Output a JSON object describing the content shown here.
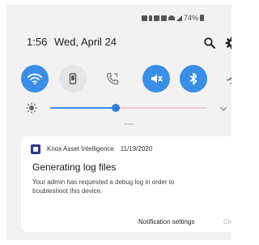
{
  "status_bar": {
    "battery": "74%",
    "icons": [
      "nfc-icon",
      "bluetooth-icon",
      "vibrate-icon",
      "mute-icon",
      "wifi-icon",
      "signal-icon",
      "battery-icon"
    ]
  },
  "header": {
    "time": "1:56",
    "date": "Wed, April 24",
    "search_icon": "search-icon",
    "settings_icon": "gear-icon"
  },
  "quick_settings": [
    {
      "name": "wifi",
      "icon": "wifi-icon",
      "state": "on"
    },
    {
      "name": "portrait",
      "icon": "phone-portrait-icon",
      "state": "off"
    },
    {
      "name": "call",
      "icon": "phone-call-icon",
      "state": "off"
    },
    {
      "name": "mute",
      "icon": "mute-icon",
      "state": "on"
    },
    {
      "name": "bluetooth",
      "icon": "bluetooth-icon",
      "state": "on"
    },
    {
      "name": "airplane",
      "icon": "airplane-icon",
      "state": "off"
    }
  ],
  "brightness": {
    "level": 0.42,
    "icon": "sun-icon",
    "expand_icon": "chevron-down-icon"
  },
  "notification": {
    "app_name": "Knox Asset Intelligence",
    "timestamp": "11/19/2020",
    "title": "Generating log files",
    "body": "Your admin has requested a debug log in order to troubleshoot this device.",
    "action_settings": "Notification settings",
    "action_clear": "Clear"
  },
  "colors": {
    "accent": "#3a8ee6",
    "tile_off": "#e4e5e7",
    "panel_bg": "#f2f2f3",
    "slider_track": "#f0c7cc"
  }
}
